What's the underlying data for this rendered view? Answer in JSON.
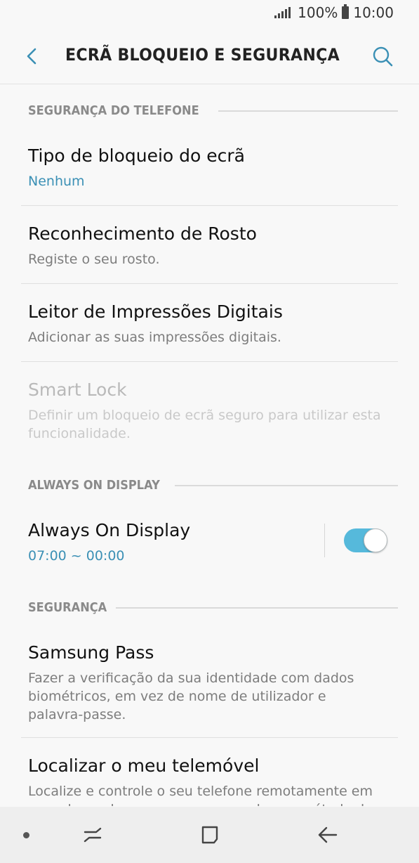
{
  "status_bar": {
    "battery_text": "100%",
    "time": "10:00",
    "icons": [
      "signal-icon",
      "battery-icon"
    ]
  },
  "app_bar": {
    "title": "ECRÃ BLOQUEIO E SEGURANÇA",
    "icons": [
      "back-arrow-icon",
      "search-icon"
    ],
    "accent_color": "#3b90b5"
  },
  "sections": {
    "phone_security": {
      "header": "SEGURANÇA DO TELEFONE",
      "items": [
        {
          "title": "Tipo de bloqueio do ecrã",
          "subtitle": "Nenhum"
        },
        {
          "title": "Reconhecimento de Rosto",
          "subtitle": "Registe o seu rosto."
        },
        {
          "title": "Leitor de Impressões Digitais",
          "subtitle": "Adicionar as suas impressões digitais."
        },
        {
          "title": "Smart Lock",
          "subtitle_line1": "Definir um bloqueio de ecrã seguro para utilizar esta",
          "subtitle_line2": "funcionalidade.",
          "disabled": true
        }
      ]
    },
    "always_on": {
      "header": "ALWAYS ON DISPLAY",
      "item": {
        "title": "Always On Display",
        "subtitle": "07:00 ~ 00:00",
        "toggle_on": true,
        "toggle_color": "#56b9db"
      }
    },
    "security": {
      "header": "SEGURANÇA",
      "items": [
        {
          "title": "Samsung Pass",
          "subtitle_line1": "Fazer a verificação da sua identidade com dados",
          "subtitle_line2": "biométricos, em vez de nome de utilizador e",
          "subtitle_line3": "palavra-passe."
        },
        {
          "title": "Localizar o meu telemóvel",
          "subtitle_line1": "Localize e controle o seu telefone remotamente em",
          "subtitle_line2": "caso de perda ou se se esquecer do seu método de"
        }
      ]
    }
  },
  "nav_bar": {
    "icons": [
      "nav-dot-icon",
      "recent-apps-icon",
      "home-icon",
      "back-icon"
    ]
  }
}
